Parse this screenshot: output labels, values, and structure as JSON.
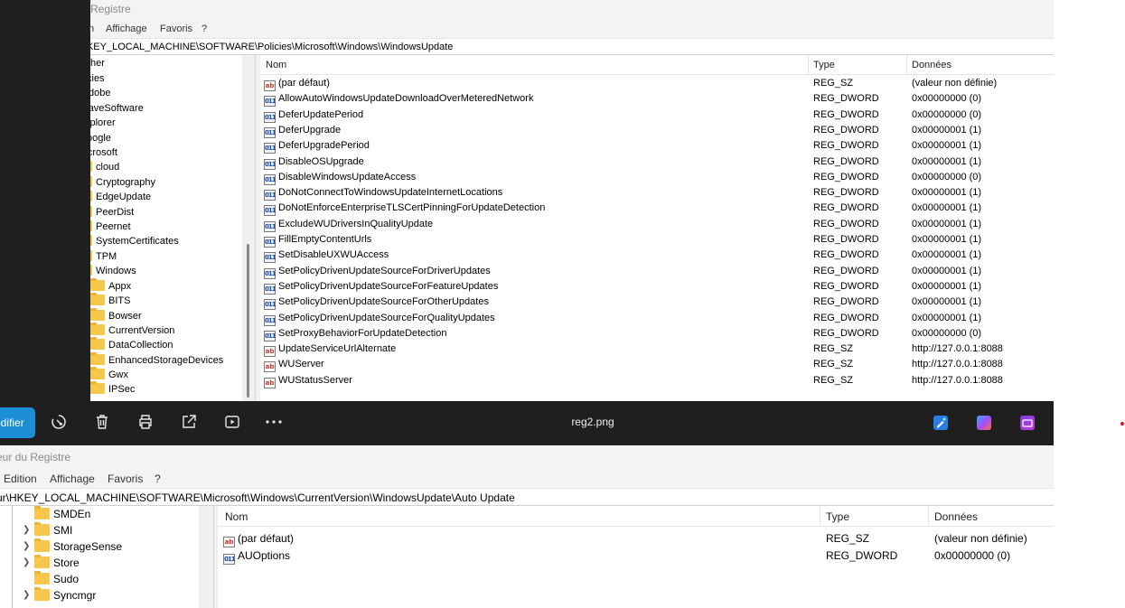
{
  "top_window": {
    "title": "Registre",
    "menu": [
      "n",
      "Affichage",
      "Favoris",
      "?"
    ],
    "address": "HKEY_LOCAL_MACHINE\\SOFTWARE\\Policies\\Microsoft\\Windows\\WindowsUpdate",
    "tree": [
      {
        "label": "her",
        "level": 0
      },
      {
        "label": "cies",
        "level": 0
      },
      {
        "label": "dobe",
        "level": 0
      },
      {
        "label": "raveSoftware",
        "level": 0
      },
      {
        "label": "xplorer",
        "level": 0
      },
      {
        "label": "oogle",
        "level": 0
      },
      {
        "label": "licrosoft",
        "level": 0
      },
      {
        "label": "cloud",
        "level": 1
      },
      {
        "label": "Cryptography",
        "level": 1
      },
      {
        "label": "EdgeUpdate",
        "level": 1
      },
      {
        "label": "PeerDist",
        "level": 1
      },
      {
        "label": "Peernet",
        "level": 1
      },
      {
        "label": "SystemCertificates",
        "level": 1
      },
      {
        "label": "TPM",
        "level": 1
      },
      {
        "label": "Windows",
        "level": 1
      },
      {
        "label": "Appx",
        "level": 2
      },
      {
        "label": "BITS",
        "level": 2
      },
      {
        "label": "Bowser",
        "level": 2
      },
      {
        "label": "CurrentVersion",
        "level": 2
      },
      {
        "label": "DataCollection",
        "level": 2
      },
      {
        "label": "EnhancedStorageDevices",
        "level": 2
      },
      {
        "label": "Gwx",
        "level": 2
      },
      {
        "label": "IPSec",
        "level": 2
      }
    ],
    "columns": {
      "name": "Nom",
      "type": "Type",
      "data": "Données"
    },
    "values": [
      {
        "icon": "string-value-icon",
        "name": "(par défaut)",
        "type": "REG_SZ",
        "data": "(valeur non définie)"
      },
      {
        "icon": "dword-value-icon",
        "name": "AllowAutoWindowsUpdateDownloadOverMeteredNetwork",
        "type": "REG_DWORD",
        "data": "0x00000000 (0)"
      },
      {
        "icon": "dword-value-icon",
        "name": "DeferUpdatePeriod",
        "type": "REG_DWORD",
        "data": "0x00000000 (0)"
      },
      {
        "icon": "dword-value-icon",
        "name": "DeferUpgrade",
        "type": "REG_DWORD",
        "data": "0x00000001 (1)"
      },
      {
        "icon": "dword-value-icon",
        "name": "DeferUpgradePeriod",
        "type": "REG_DWORD",
        "data": "0x00000001 (1)"
      },
      {
        "icon": "dword-value-icon",
        "name": "DisableOSUpgrade",
        "type": "REG_DWORD",
        "data": "0x00000001 (1)"
      },
      {
        "icon": "dword-value-icon",
        "name": "DisableWindowsUpdateAccess",
        "type": "REG_DWORD",
        "data": "0x00000000 (0)"
      },
      {
        "icon": "dword-value-icon",
        "name": "DoNotConnectToWindowsUpdateInternetLocations",
        "type": "REG_DWORD",
        "data": "0x00000001 (1)"
      },
      {
        "icon": "dword-value-icon",
        "name": "DoNotEnforceEnterpriseTLSCertPinningForUpdateDetection",
        "type": "REG_DWORD",
        "data": "0x00000001 (1)"
      },
      {
        "icon": "dword-value-icon",
        "name": "ExcludeWUDriversInQualityUpdate",
        "type": "REG_DWORD",
        "data": "0x00000001 (1)"
      },
      {
        "icon": "dword-value-icon",
        "name": "FillEmptyContentUrls",
        "type": "REG_DWORD",
        "data": "0x00000001 (1)"
      },
      {
        "icon": "dword-value-icon",
        "name": "SetDisableUXWUAccess",
        "type": "REG_DWORD",
        "data": "0x00000001 (1)"
      },
      {
        "icon": "dword-value-icon",
        "name": "SetPolicyDrivenUpdateSourceForDriverUpdates",
        "type": "REG_DWORD",
        "data": "0x00000001 (1)"
      },
      {
        "icon": "dword-value-icon",
        "name": "SetPolicyDrivenUpdateSourceForFeatureUpdates",
        "type": "REG_DWORD",
        "data": "0x00000001 (1)"
      },
      {
        "icon": "dword-value-icon",
        "name": "SetPolicyDrivenUpdateSourceForOtherUpdates",
        "type": "REG_DWORD",
        "data": "0x00000001 (1)"
      },
      {
        "icon": "dword-value-icon",
        "name": "SetPolicyDrivenUpdateSourceForQualityUpdates",
        "type": "REG_DWORD",
        "data": "0x00000001 (1)"
      },
      {
        "icon": "dword-value-icon",
        "name": "SetProxyBehaviorForUpdateDetection",
        "type": "REG_DWORD",
        "data": "0x00000000 (0)"
      },
      {
        "icon": "string-value-icon",
        "name": "UpdateServiceUrlAlternate",
        "type": "REG_SZ",
        "data": "http://127.0.0.1:8088"
      },
      {
        "icon": "string-value-icon",
        "name": "WUServer",
        "type": "REG_SZ",
        "data": "http://127.0.0.1:8088"
      },
      {
        "icon": "string-value-icon",
        "name": "WUStatusServer",
        "type": "REG_SZ",
        "data": "http://127.0.0.1:8088"
      }
    ]
  },
  "viewer_toolbar": {
    "modify_label": "odifier",
    "file_name": "reg2.png",
    "icons": [
      "enhance-icon",
      "delete-icon",
      "print-icon",
      "share-icon",
      "slideshow-icon",
      "more-icon"
    ],
    "app_icons": [
      "designer-icon",
      "copilot-icon",
      "clipchamp-icon"
    ],
    "colors": {
      "background": "#1f1f1f",
      "accent": "#1c8fd4"
    }
  },
  "bottom_window": {
    "title": "eur du Registre",
    "menu": [
      "Edition",
      "Affichage",
      "Favoris",
      "?"
    ],
    "address": "ur\\HKEY_LOCAL_MACHINE\\SOFTWARE\\Microsoft\\Windows\\CurrentVersion\\WindowsUpdate\\Auto Update",
    "tree": [
      {
        "label": "SMDEn",
        "expandable": false
      },
      {
        "label": "SMI",
        "expandable": true
      },
      {
        "label": "StorageSense",
        "expandable": true
      },
      {
        "label": "Store",
        "expandable": true
      },
      {
        "label": "Sudo",
        "expandable": false
      },
      {
        "label": "Syncmgr",
        "expandable": true
      }
    ],
    "columns": {
      "name": "Nom",
      "type": "Type",
      "data": "Données"
    },
    "values": [
      {
        "icon": "string-value-icon",
        "name": "(par défaut)",
        "type": "REG_SZ",
        "data": "(valeur non définie)"
      },
      {
        "icon": "dword-value-icon",
        "name": "AUOptions",
        "type": "REG_DWORD",
        "data": "0x00000000 (0)"
      }
    ]
  }
}
